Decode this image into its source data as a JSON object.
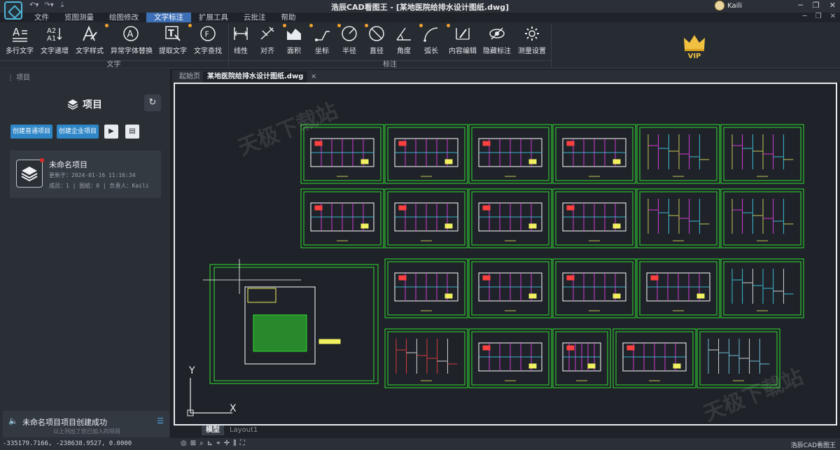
{
  "titlebar": {
    "title": "浩辰CAD看图王 - [某地医院给排水设计图纸.dwg]",
    "user_name": "Kaili"
  },
  "menu": [
    "文件",
    "览图测量",
    "绘图修改",
    "文字标注",
    "扩展工具",
    "云批注",
    "帮助"
  ],
  "active_menu_index": 3,
  "ribbon": {
    "text_group_label": "文字",
    "dim_group_label": "标注",
    "text_tools": [
      {
        "label": "多行文字",
        "icon": "multiline-text-icon"
      },
      {
        "label": "文字递增",
        "icon": "text-increment-icon"
      },
      {
        "label": "文字样式",
        "icon": "text-style-icon"
      },
      {
        "label": "异常字体替换",
        "icon": "font-replace-icon"
      },
      {
        "label": "提取文字",
        "icon": "extract-text-icon"
      },
      {
        "label": "文字查找",
        "icon": "text-search-icon"
      }
    ],
    "dim_tools": [
      {
        "label": "线性",
        "icon": "linear-dim-icon"
      },
      {
        "label": "对齐",
        "icon": "aligned-dim-icon"
      },
      {
        "label": "面积",
        "icon": "area-icon"
      },
      {
        "label": "坐标",
        "icon": "coordinate-icon"
      },
      {
        "label": "半径",
        "icon": "radius-icon"
      },
      {
        "label": "直径",
        "icon": "diameter-icon"
      },
      {
        "label": "角度",
        "icon": "angle-icon"
      },
      {
        "label": "弧长",
        "icon": "arc-length-icon"
      },
      {
        "label": "内容编辑",
        "icon": "content-edit-icon"
      },
      {
        "label": "隐藏标注",
        "icon": "hide-dim-icon"
      },
      {
        "label": "测量设置",
        "icon": "measure-settings-icon"
      }
    ],
    "vip_label": "VIP"
  },
  "left_panel": {
    "header": "项目",
    "title": "项目",
    "create_normal": "创建普通项目",
    "create_enterprise": "创建企业项目",
    "project": {
      "name": "未命名项目",
      "updated": "更新于：2024-01-16 11:16:34",
      "meta": "成员：1 | 图纸：0 | 负责人：Kaili"
    },
    "notice_main": "未命名项目项目创建成功",
    "notice_sub": "以上列出了您已加入的项目"
  },
  "tabs": {
    "start": "起始页",
    "file": "某地医院给排水设计图纸.dwg",
    "close": "×"
  },
  "layout_tabs": {
    "model": "模型",
    "layout1": "Layout1"
  },
  "watermark": "天极下载站",
  "axes": {
    "x": "X",
    "y": "Y"
  },
  "status": {
    "coords": "-335179.7166, -238638.9527, 0.0000",
    "app_name": "浩辰CAD看图王"
  }
}
